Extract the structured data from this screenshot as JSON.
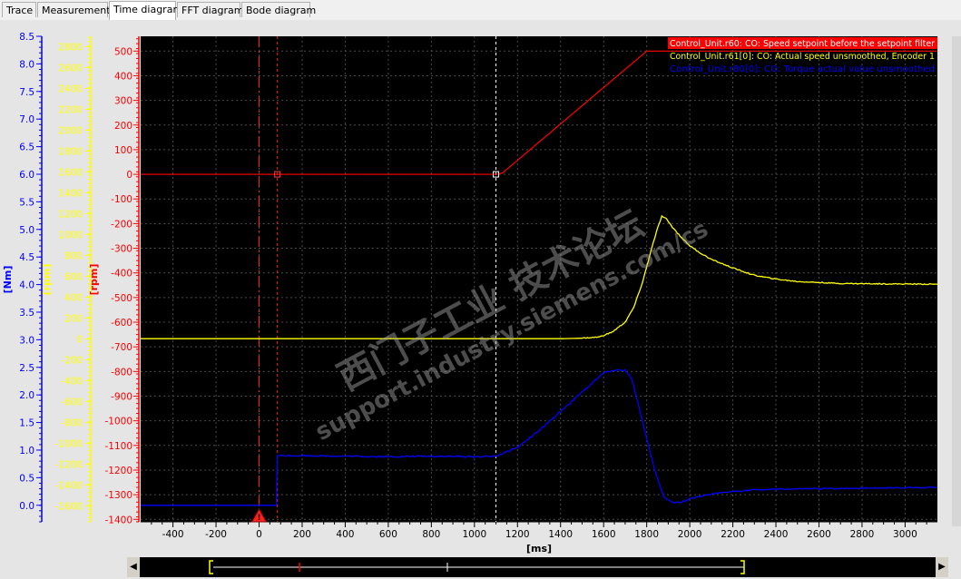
{
  "tabs": [
    {
      "label": "Trace"
    },
    {
      "label": "Measurements"
    },
    {
      "label": "Time diagram"
    },
    {
      "label": "FFT diagram"
    },
    {
      "label": "Bode diagram"
    }
  ],
  "active_tab": "Time diagram",
  "watermark": {
    "line1": "西门子工业 技术论坛",
    "line2": "support.industry.siemens.com/cs"
  },
  "colors": {
    "background": "#000000",
    "speed_setpoint": "#ff0000",
    "actual_speed": "#ffff00",
    "torque": "#0000ff",
    "grid": "#555555",
    "cursor": "#ffffff"
  },
  "chart_data": {
    "type": "line",
    "xlabel": "[ms]",
    "xlim": [
      -550,
      3150
    ],
    "x_ticks": [
      -400,
      -200,
      0,
      200,
      400,
      600,
      800,
      1000,
      1200,
      1400,
      1600,
      1800,
      2000,
      2200,
      2400,
      2600,
      2800,
      3000
    ],
    "grid": true,
    "legend_position": "top-right",
    "axes": [
      {
        "id": "nm",
        "label": "[Nm]",
        "color": "#0000ff",
        "lim": [
          -0.3,
          8.5
        ],
        "ticks": [
          "8.5",
          "8.0",
          "7.5",
          "7.0",
          "6.5",
          "6.0",
          "5.5",
          "5.0",
          "4.5",
          "4.0",
          "3.5",
          "3.0",
          "2.5",
          "2.0",
          "1.5",
          "1.0",
          "0.5",
          "0.0"
        ]
      },
      {
        "id": "rpm_y",
        "label": "[rpm]",
        "color": "#ffff00",
        "lim": [
          -1750,
          2900
        ],
        "ticks": [
          "2800",
          "2600",
          "2400",
          "2200",
          "2000",
          "1800",
          "1600",
          "1400",
          "1200",
          "1000",
          "800",
          "600",
          "400",
          "200",
          "0",
          "-200",
          "-400",
          "-600",
          "-800",
          "-1000",
          "-1200",
          "-1400",
          "-1600"
        ]
      },
      {
        "id": "rpm_r",
        "label": "[rpm]",
        "color": "#ff0000",
        "lim": [
          -1410,
          560
        ],
        "ticks": [
          "500",
          "400",
          "300",
          "200",
          "100",
          "0",
          "-100",
          "-200",
          "-300",
          "-400",
          "-500",
          "-600",
          "-700",
          "-800",
          "-900",
          "-1000",
          "-1100",
          "-1200",
          "-1300",
          "-1400"
        ]
      }
    ],
    "series": [
      {
        "name": "Control_Unit.r60: CO: Speed setpoint before the setpoint filter",
        "axis": "rpm_r",
        "color": "#ff0000",
        "x": [
          -550,
          1100,
          1130,
          1800,
          3150
        ],
        "y": [
          0,
          0,
          5,
          500,
          500
        ]
      },
      {
        "name": "Control_Unit.r61[0]: CO: Actual speed unsmoothed, Encoder 1",
        "axis": "rpm_r",
        "color": "#ffff00",
        "x": [
          -550,
          1400,
          1500,
          1580,
          1640,
          1700,
          1740,
          1780,
          1820,
          1850,
          1870,
          1890,
          1920,
          1960,
          2000,
          2050,
          2100,
          2200,
          2300,
          2400,
          2500,
          2700,
          3000,
          3150
        ],
        "y": [
          -667,
          -667,
          -665,
          -660,
          -640,
          -600,
          -540,
          -440,
          -310,
          -220,
          -170,
          -180,
          -215,
          -255,
          -290,
          -320,
          -345,
          -380,
          -410,
          -425,
          -435,
          -443,
          -445,
          -446
        ]
      },
      {
        "name": "Control_Unit.r80[0]: CO: Torque actual value unsmoothed",
        "axis": "nm",
        "color": "#0000ff",
        "x": [
          -550,
          80,
          85,
          200,
          400,
          600,
          800,
          1000,
          1100,
          1200,
          1300,
          1400,
          1500,
          1600,
          1650,
          1700,
          1730,
          1760,
          1800,
          1840,
          1880,
          1920,
          1960,
          2000,
          2100,
          2200,
          2300,
          2400,
          2600,
          2800,
          3000,
          3150
        ],
        "y": [
          0.0,
          0.0,
          0.9,
          0.9,
          0.89,
          0.88,
          0.89,
          0.88,
          0.89,
          1.05,
          1.35,
          1.7,
          2.05,
          2.4,
          2.45,
          2.45,
          2.3,
          1.85,
          1.2,
          0.6,
          0.15,
          0.05,
          0.05,
          0.12,
          0.2,
          0.25,
          0.28,
          0.29,
          0.3,
          0.31,
          0.32,
          0.32
        ]
      }
    ],
    "cursors": [
      0,
      85,
      1100
    ],
    "markers": [
      {
        "x": 85,
        "y": 0,
        "axis": "rpm_r"
      },
      {
        "x": 1100,
        "y": 0,
        "axis": "rpm_r"
      }
    ],
    "trigger_x": 0
  }
}
